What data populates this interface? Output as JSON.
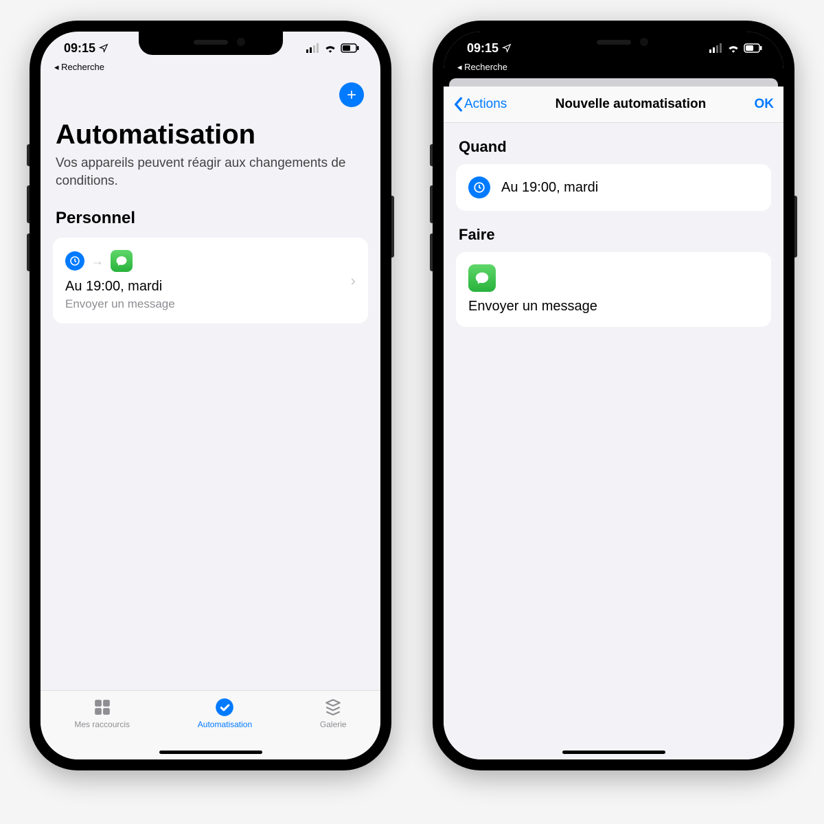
{
  "status": {
    "time": "09:15",
    "back_app": "◂ Recherche"
  },
  "screen1": {
    "title": "Automatisation",
    "subtitle": "Vos appareils peuvent réagir aux changements de conditions.",
    "section": "Personnel",
    "automation": {
      "title": "Au 19:00, mardi",
      "subtitle": "Envoyer un message"
    },
    "tabs": {
      "shortcuts": "Mes raccourcis",
      "automation": "Automatisation",
      "gallery": "Galerie"
    }
  },
  "screen2": {
    "nav_back": "Actions",
    "nav_title": "Nouvelle automatisation",
    "nav_ok": "OK",
    "when_heading": "Quand",
    "when_text": "Au 19:00, mardi",
    "do_heading": "Faire",
    "do_text": "Envoyer un message"
  },
  "icons": {
    "clock": "clock-icon",
    "messages": "messages-icon",
    "add": "add-icon"
  }
}
